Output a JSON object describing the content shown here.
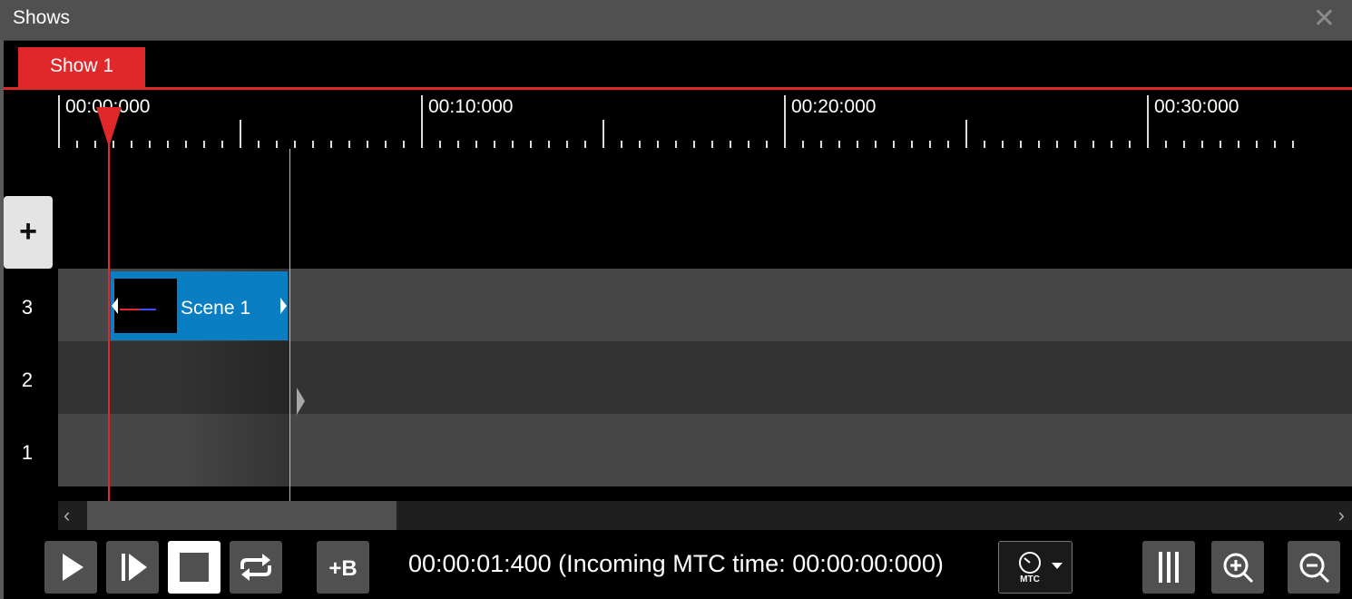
{
  "window": {
    "title": "Shows",
    "close_icon": "close-icon"
  },
  "tabs": [
    {
      "label": "Show 1",
      "active": true
    }
  ],
  "accent_color": "#e0282a",
  "clip_color": "#0a7ec2",
  "ruler": {
    "labels": [
      "00:00:000",
      "00:10:000",
      "00:20:000",
      "00:30:000"
    ]
  },
  "add_track_label": "+",
  "tracks": [
    {
      "number": "3"
    },
    {
      "number": "2"
    },
    {
      "number": "1"
    }
  ],
  "clip": {
    "label": "Scene 1",
    "track": "3"
  },
  "transport": {
    "time_text": "00:00:01:400 (Incoming MTC time: 00:00:00:000)",
    "add_blackout_label": "+B",
    "sync_label": "MTC"
  }
}
